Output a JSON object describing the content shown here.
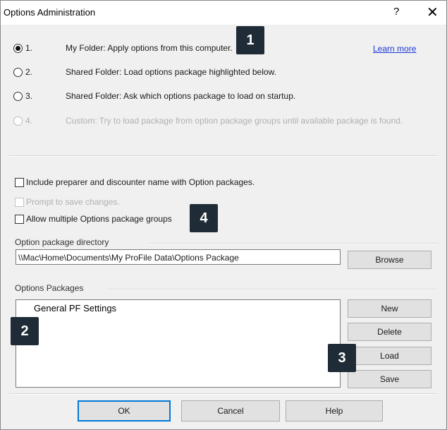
{
  "window": {
    "title": "Options Administration",
    "help_icon": "?",
    "close_icon": "✕"
  },
  "options": [
    {
      "num": "1.",
      "text": "My Folder: Apply options from this computer.",
      "checked": true,
      "enabled": true
    },
    {
      "num": "2.",
      "text": "Shared Folder: Load options package highlighted below.",
      "checked": false,
      "enabled": true
    },
    {
      "num": "3.",
      "text": "Shared Folder: Ask which options package to load on startup.",
      "checked": false,
      "enabled": true
    },
    {
      "num": "4.",
      "text": "Custom: Try to load package from option package groups until available package is found.",
      "checked": false,
      "enabled": false
    }
  ],
  "learn_more": "Learn more",
  "checkboxes": [
    {
      "label": "Include preparer and discounter name with Option packages.",
      "checked": false,
      "enabled": true
    },
    {
      "label": "Prompt to save changes.",
      "checked": false,
      "enabled": false
    },
    {
      "label": "Allow multiple Options package groups",
      "checked": false,
      "enabled": true
    }
  ],
  "directory": {
    "label": "Option package directory",
    "value": "\\\\Mac\\Home\\Documents\\My ProFile Data\\Options Package",
    "browse": "Browse"
  },
  "packages": {
    "label": "Options Packages",
    "items": [
      "General PF Settings"
    ],
    "buttons": {
      "new": "New",
      "delete": "Delete",
      "load": "Load",
      "save": "Save"
    }
  },
  "footer": {
    "ok": "OK",
    "cancel": "Cancel",
    "help": "Help"
  },
  "callouts": [
    "1",
    "2",
    "3",
    "4"
  ]
}
